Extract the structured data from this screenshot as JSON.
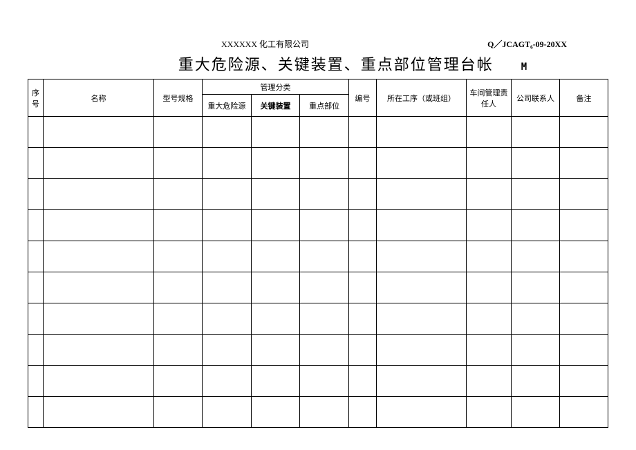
{
  "header": {
    "company": "XXXXXX 化工有限公司",
    "doc_code": "Q／JCAGT₆-09-20XX"
  },
  "title": {
    "main": "重大危险源、关键装置、重点部位管理台帐",
    "suffix": "M"
  },
  "columns": {
    "seq": "序号",
    "name": "名称",
    "model": "型号规格",
    "category_group": "管理分类",
    "category_major": "重大危险源",
    "category_key": "关键装置",
    "category_point": "重点部位",
    "number": "编号",
    "process": "所在工序（或班组）",
    "responsible": "车间管理责任人",
    "contact": "公司联系人",
    "remark": "备注"
  },
  "rows": [
    {},
    {},
    {},
    {},
    {},
    {},
    {},
    {},
    {},
    {}
  ]
}
